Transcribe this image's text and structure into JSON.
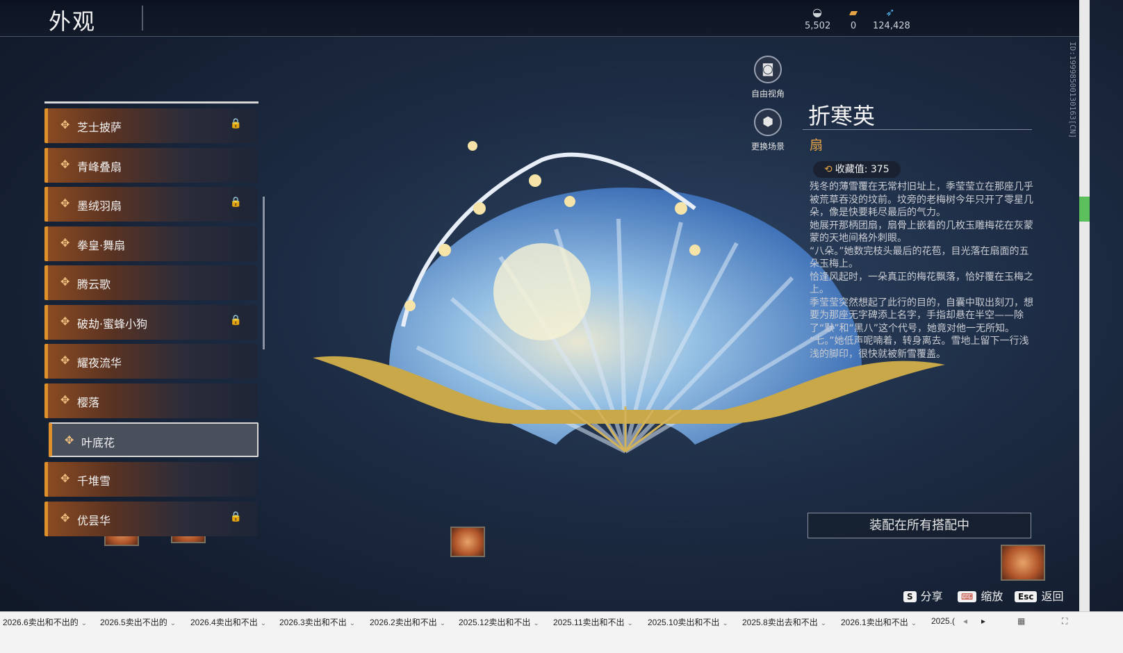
{
  "header": {
    "title": "外观"
  },
  "currencies": [
    {
      "icon": "mask-currency-icon",
      "value": "5,502"
    },
    {
      "icon": "ticket-currency-icon",
      "value": "0"
    },
    {
      "icon": "feather-currency-icon",
      "value": "124,428"
    }
  ],
  "side_id": "ID:19998500130163[CN]",
  "list": {
    "items": [
      {
        "label": "芝士披萨",
        "locked": true
      },
      {
        "label": "青峰叠扇",
        "locked": false
      },
      {
        "label": "墨绒羽扇",
        "locked": true
      },
      {
        "label": "拳皇·舞扇",
        "locked": false
      },
      {
        "label": "腾云歌",
        "locked": false
      },
      {
        "label": "破劫·蜜蜂小狗",
        "locked": true
      },
      {
        "label": "耀夜流华",
        "locked": false
      },
      {
        "label": "樱落",
        "locked": false
      },
      {
        "label": "叶底花",
        "locked": false,
        "selected": true
      },
      {
        "label": "千堆雪",
        "locked": false
      },
      {
        "label": "优昙华",
        "locked": true
      }
    ],
    "lock_glyph": "🔒",
    "deco_glyph": "✥"
  },
  "camera": {
    "free_view_label": "自由视角",
    "change_scene_label": "更换场景"
  },
  "detail": {
    "name": "折寒英",
    "type": "扇",
    "collect_label": "收藏值: 375",
    "description": [
      "残冬的薄雪覆在无常村旧址上，季莹莹立在那座几乎被荒草吞没的坟前。坟旁的老梅树今年只开了零星几朵，像是快要耗尽最后的气力。",
      "她展开那柄团扇，扇骨上嵌着的几枚玉雕梅花在灰蒙蒙的天地间格外刺眼。",
      "“八朵。”她数完枝头最后的花苞，目光落在扇面的五朵玉梅上。",
      "恰逢风起时，一朵真正的梅花飘落，恰好覆在玉梅之上。",
      "季莹莹突然想起了此行的目的，自囊中取出刻刀，想要为那座无字碑添上名字，手指却悬在半空——除了“默”和“黑八”这个代号，她竟对他一无所知。",
      "“七。”她低声呢喃着，转身离去。雪地上留下一行浅浅的脚印，很快就被新雪覆盖。"
    ],
    "equip_label": "装配在所有搭配中"
  },
  "hints": [
    {
      "key": "S",
      "label": "分享"
    },
    {
      "key": "⌨",
      "label": "缩放"
    },
    {
      "key": "Esc",
      "label": "返回"
    }
  ],
  "taskbar": {
    "tabs": [
      "2026.6卖出和不出的",
      "2026.5卖出不出的",
      "2026.4卖出和不出",
      "2026.3卖出和不出",
      "2026.2卖出和不出",
      "2025.12卖出和不出",
      "2025.11卖出和不出",
      "2025.10卖出和不出",
      "2025.8卖出去和不出",
      "2026.1卖出和不出",
      "2025.("
    ]
  }
}
